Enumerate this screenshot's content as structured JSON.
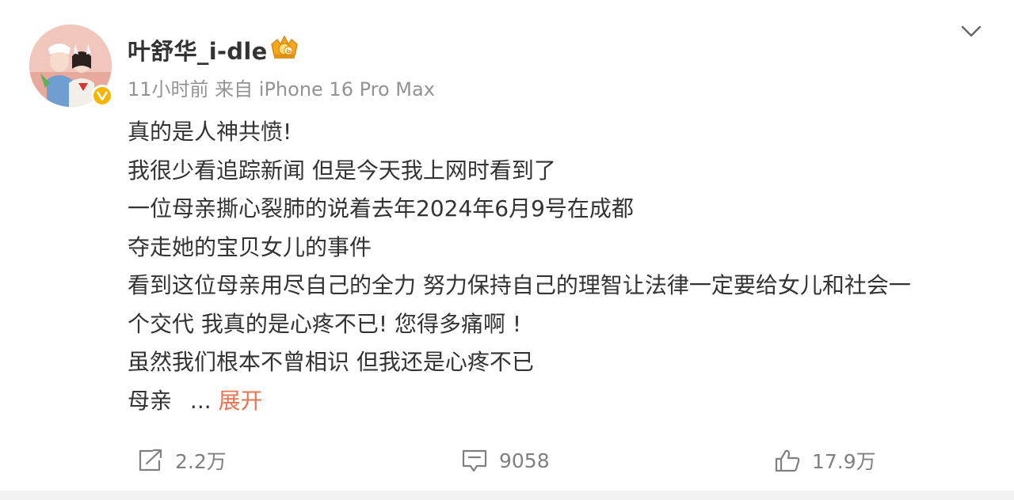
{
  "post": {
    "author": "叶舒华_i-dle",
    "meta": "11小时前 来自 iPhone 16 Pro Max",
    "lines": [
      "真的是人神共愤!",
      "我很少看追踪新闻 但是今天我上网时看到了",
      "一位母亲撕心裂肺的说着去年2024年6月9号在成都",
      "夺走她的宝贝女儿的事件",
      "看到这位母亲用尽自己的全力 努力保持自己的理智让法律一定要给女儿和社会一",
      "个交代 我真的是心疼不已! 您得多痛啊 !",
      "虽然我们根本不曾相识 但我还是心疼不已"
    ],
    "last_line": "母亲",
    "ellipsis": "...",
    "expand_label": "展开"
  },
  "actions": {
    "repost_count": "2.2万",
    "comment_count": "9058",
    "like_count": "17.9万"
  },
  "icons": {
    "menu": "chevron-down-icon",
    "verified": "verified-badge-icon",
    "member": "crown-badge-icon",
    "repost": "share-icon",
    "comment": "comment-icon",
    "like": "thumbs-up-icon"
  },
  "colors": {
    "accent": "#eb7350",
    "verified": "#f7b500",
    "text": "#333333",
    "meta": "#939393"
  }
}
